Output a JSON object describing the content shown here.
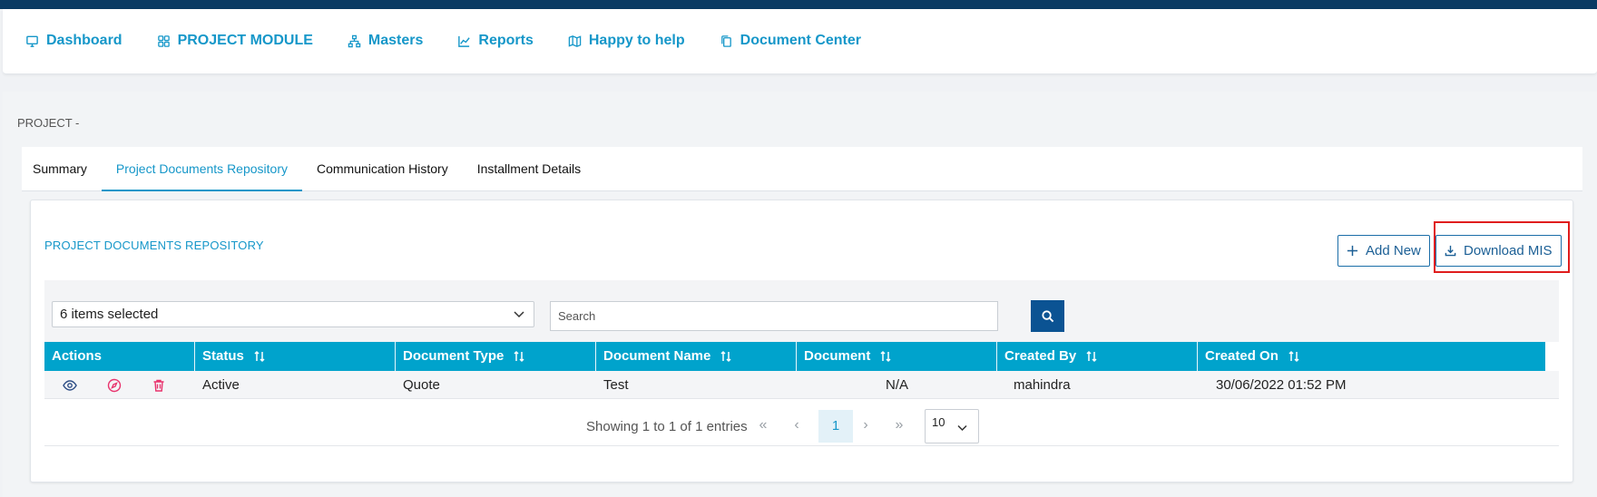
{
  "nav": {
    "items": [
      {
        "label": "Dashboard",
        "icon": "monitor-icon"
      },
      {
        "label": "PROJECT MODULE",
        "icon": "grid-icon"
      },
      {
        "label": "Masters",
        "icon": "sitemap-icon"
      },
      {
        "label": "Reports",
        "icon": "chart-line-icon"
      },
      {
        "label": "Happy to help",
        "icon": "map-icon"
      },
      {
        "label": "Document Center",
        "icon": "copy-icon"
      }
    ]
  },
  "page": {
    "project_label": "PROJECT -"
  },
  "tabs": [
    {
      "label": "Summary",
      "active": false
    },
    {
      "label": "Project Documents Repository",
      "active": true
    },
    {
      "label": "Communication History",
      "active": false
    },
    {
      "label": "Installment Details",
      "active": false
    }
  ],
  "panel": {
    "title": "PROJECT DOCUMENTS REPOSITORY",
    "add_new_label": "Add New",
    "download_label": "Download MIS"
  },
  "filters": {
    "column_select_value": "6 items selected",
    "search_placeholder": "Search"
  },
  "table": {
    "headers": [
      "Actions",
      "Status",
      "Document Type",
      "Document Name",
      "Document",
      "Created By",
      "Created On"
    ],
    "rows": [
      {
        "status": "Active",
        "document_type": "Quote",
        "document_name": "Test",
        "document": "N/A",
        "created_by": "mahindra",
        "created_on": "30/06/2022 01:52 PM"
      }
    ]
  },
  "pagination": {
    "showing_text": "Showing 1 to 1 of 1 entries",
    "first": "«",
    "prev": "‹",
    "current_page": "1",
    "next": "›",
    "last": "»",
    "page_size": "10"
  },
  "colors": {
    "accent": "#1697c9",
    "header_bg": "#00a3cc",
    "topbar": "#0a3a63",
    "highlight": "#e01d1d"
  }
}
